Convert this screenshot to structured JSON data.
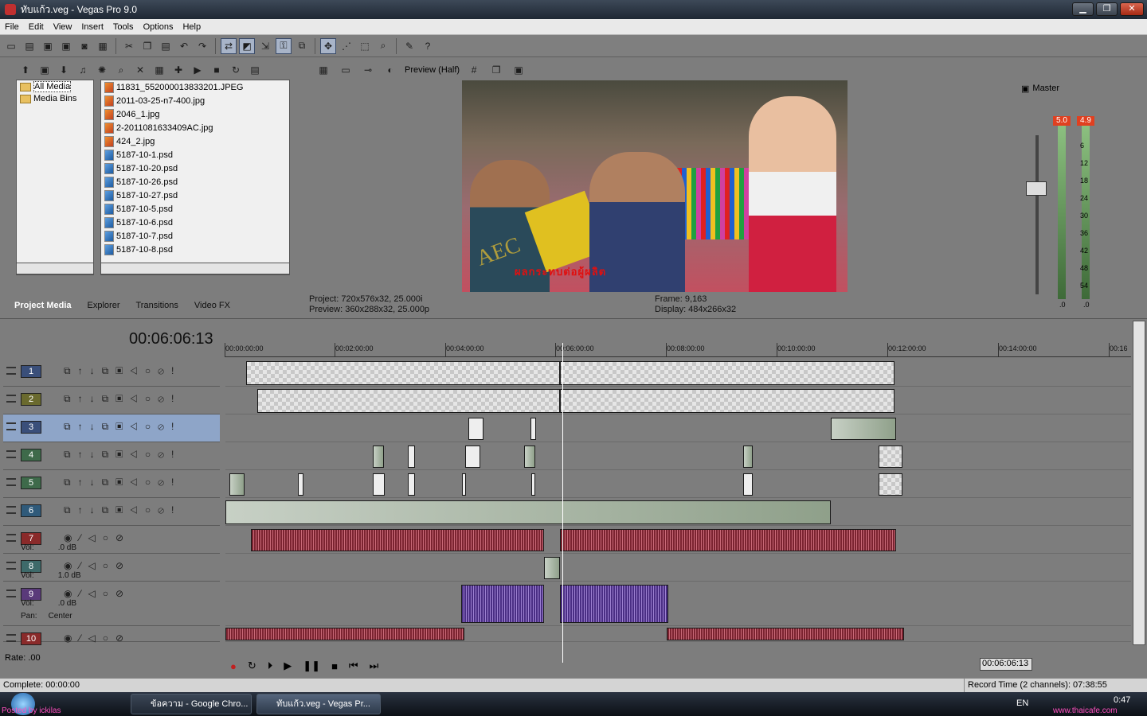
{
  "window": {
    "title": "ทับแก้ว.veg - Vegas Pro 9.0"
  },
  "menu": [
    "File",
    "Edit",
    "View",
    "Insert",
    "Tools",
    "Options",
    "Help"
  ],
  "media_tree": [
    "All Media",
    "Media Bins"
  ],
  "media_files": [
    "11831_552000013833201.JPEG",
    "2011-03-25-n7-400.jpg",
    "2046_1.jpg",
    "2-2011081633409AC.jpg",
    "424_2.jpg",
    "5187-10-1.psd",
    "5187-10-20.psd",
    "5187-10-26.psd",
    "5187-10-27.psd",
    "5187-10-5.psd",
    "5187-10-6.psd",
    "5187-10-7.psd",
    "5187-10-8.psd"
  ],
  "media_tabs": [
    "Project Media",
    "Explorer",
    "Transitions",
    "Video FX"
  ],
  "preview": {
    "quality": "Preview (Half)",
    "project": "Project:  720x576x32, 25.000i",
    "preview": "Preview:  360x288x32, 25.000p",
    "frame": "Frame:    9,163",
    "display": "Display:   484x266x32",
    "caption": "ผลกระทบต่อผู้ผลิต",
    "watermark": "AEC"
  },
  "master": {
    "label": "Master",
    "peak_l": "5.0",
    "peak_r": "4.9",
    "scale": [
      "6",
      "12",
      "18",
      "24",
      "30",
      "36",
      "42",
      "48",
      "54"
    ],
    "bottom_l": ".0",
    "bottom_r": ".0"
  },
  "timeline": {
    "timecode": "00:06:06:13",
    "ruler": [
      "00:00:00:00",
      "00:02:00:00",
      "00:04:00:00",
      "00:06:00:00",
      "00:08:00:00",
      "00:10:00:00",
      "00:12:00:00",
      "00:14:00:00",
      "00:16"
    ],
    "tracks": [
      {
        "num": "1",
        "type": "video",
        "color": "#3a4f7a"
      },
      {
        "num": "2",
        "type": "video",
        "color": "#6a6a2e"
      },
      {
        "num": "3",
        "type": "video",
        "color": "#3a4f7a"
      },
      {
        "num": "4",
        "type": "video",
        "color": "#3e6a4a"
      },
      {
        "num": "5",
        "type": "video",
        "color": "#3e6a4a"
      },
      {
        "num": "6",
        "type": "video",
        "color": "#2f5a7a"
      },
      {
        "num": "7",
        "type": "audio",
        "color": "#8a2a2a",
        "vol_label": "Vol:",
        "vol": ".0 dB"
      },
      {
        "num": "8",
        "type": "audio",
        "color": "#3e6a6a",
        "vol_label": "Vol:",
        "vol": "1.0 dB"
      },
      {
        "num": "9",
        "type": "audio",
        "color": "#5a3a7a",
        "vol_label": "Vol:",
        "vol": ".0 dB",
        "pan_label": "Pan:",
        "pan": "Center"
      },
      {
        "num": "10",
        "type": "audio",
        "color": "#8a2a2a"
      }
    ],
    "rate": "Rate: .00",
    "end_timecode": "00:06:06:13"
  },
  "status": {
    "left": "Complete: 00:00:00",
    "right": "Record Time (2 channels): 07:38:55"
  },
  "taskbar": {
    "items": [
      "ข้อความ - Google Chro...",
      "ทับแก้ว.veg - Vegas Pr..."
    ],
    "lang": "EN",
    "clock": "0:47",
    "watermark_left": "Posted by ickilas",
    "watermark_right": "www.thaicafe.com"
  }
}
